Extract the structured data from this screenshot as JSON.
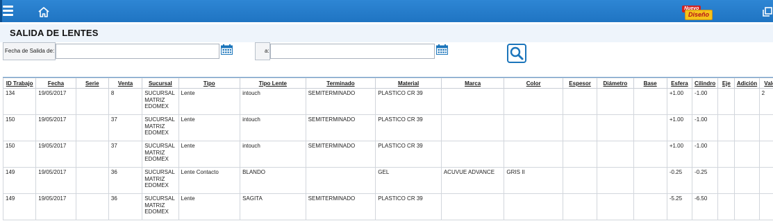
{
  "header": {
    "badge_top": "Nuevo",
    "badge_bottom": "Diseño"
  },
  "page": {
    "title": "SALIDA DE LENTES"
  },
  "filters": {
    "from_label": "Fecha de Salida de:",
    "from_value": "",
    "to_label": "a:",
    "to_value": ""
  },
  "table": {
    "columns": [
      "ID Trabajo",
      "Fecha",
      "Serie",
      "Venta",
      "Sucursal",
      "Tipo",
      "Tipo Lente",
      "Terminado",
      "Material",
      "Marca",
      "Color",
      "Espesor",
      "Diámetro",
      "Base",
      "Esfera",
      "Cilindro",
      "Eje",
      "Adición",
      "Vale"
    ],
    "rows": [
      [
        "134",
        "19/05/2017",
        "",
        "8",
        "SUCURSAL MATRIZ EDOMEX",
        "Lente",
        "intouch",
        "SEMITERMINADO",
        "PLASTICO CR 39",
        "",
        "",
        "",
        "",
        "",
        "+1.00",
        "-1.00",
        "",
        "",
        "2"
      ],
      [
        "150",
        "19/05/2017",
        "",
        "37",
        "SUCURSAL MATRIZ EDOMEX",
        "Lente",
        "intouch",
        "SEMITERMINADO",
        "PLASTICO CR 39",
        "",
        "",
        "",
        "",
        "",
        "+1.00",
        "-1.00",
        "",
        "",
        ""
      ],
      [
        "150",
        "19/05/2017",
        "",
        "37",
        "SUCURSAL MATRIZ EDOMEX",
        "Lente",
        "intouch",
        "SEMITERMINADO",
        "PLASTICO CR 39",
        "",
        "",
        "",
        "",
        "",
        "+1.00",
        "-1.00",
        "",
        "",
        ""
      ],
      [
        "149",
        "19/05/2017",
        "",
        "36",
        "SUCURSAL MATRIZ EDOMEX",
        "Lente Contacto",
        "BLANDO",
        "",
        "GEL",
        "ACUVUE ADVANCE",
        "GRIS II",
        "",
        "",
        "",
        "-0.25",
        "-0.25",
        "",
        "",
        ""
      ],
      [
        "149",
        "19/05/2017",
        "",
        "36",
        "SUCURSAL MATRIZ EDOMEX",
        "Lente",
        "SAGITA",
        "SEMITERMINADO",
        "PLASTICO CR 39",
        "",
        "",
        "",
        "",
        "",
        "-5.25",
        "-6.50",
        "",
        "",
        ""
      ]
    ]
  },
  "icons": {
    "menu": "menu-icon",
    "home": "home-icon",
    "calendar": "calendar-icon",
    "search": "search-icon",
    "restore": "window-restore-icon"
  },
  "colors": {
    "topbar": "#1f74c2",
    "accent": "#1b75bb",
    "title_bg": "#eef4fb"
  }
}
